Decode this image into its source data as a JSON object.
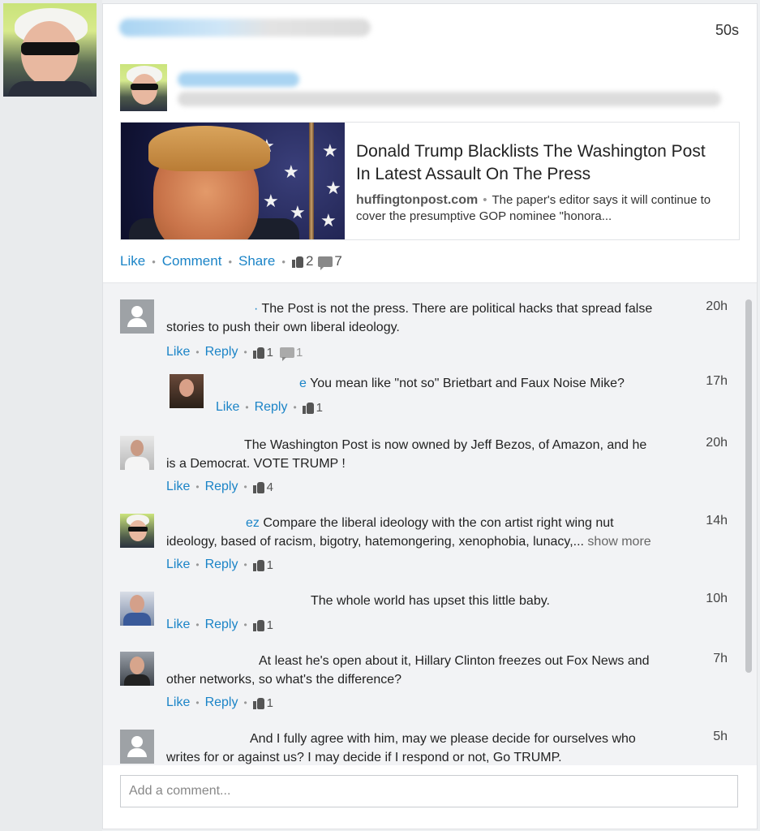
{
  "post": {
    "time": "50s",
    "article": {
      "title": "Donald Trump Blacklists The Washington Post In Latest Assault On The Press",
      "source": "huffingtonpost.com",
      "snippet": "The paper's editor says it will continue to cover the presumptive GOP nominee \"honora..."
    },
    "actions": {
      "like": "Like",
      "comment": "Comment",
      "share": "Share",
      "likes_count": "2",
      "comments_count": "7"
    }
  },
  "comments": [
    {
      "text": "The Post is not the press. There are political hacks that spread false stories to push their own liberal ideology.",
      "prefix": "·",
      "time": "20h",
      "like": "Like",
      "reply": "Reply",
      "likes": "1",
      "replies": "1"
    },
    {
      "text": "You mean like \"not so\" Brietbart and Faux Noise Mike?",
      "prefix": "e",
      "time": "17h",
      "like": "Like",
      "reply": "Reply",
      "likes": "1"
    },
    {
      "text_line1": "The Washington Post is now owned by Jeff Bezos, of Amazon, and he",
      "text_line2": "is a Democrat. VOTE TRUMP !",
      "time": "20h",
      "like": "Like",
      "reply": "Reply",
      "likes": "4"
    },
    {
      "prefix": "ez",
      "text_line1": "Compare the liberal ideology with the con artist right wing nut",
      "text_line2": "ideology, based of racism, bigotry, hatemongering, xenophobia, lunacy,...",
      "show_more": "show more",
      "time": "14h",
      "like": "Like",
      "reply": "Reply",
      "likes": "1"
    },
    {
      "text": "The whole world has upset this little baby.",
      "time": "10h",
      "like": "Like",
      "reply": "Reply",
      "likes": "1"
    },
    {
      "text_line1": "At least he's open about it, Hillary Clinton freezes out Fox News and",
      "text_line2": "other networks, so what's the difference?",
      "time": "7h",
      "like": "Like",
      "reply": "Reply",
      "likes": "1"
    },
    {
      "text_line1": "And I fully agree with him, may we please decide for ourselves who",
      "text_line2": "writes for or against us? I may decide if I respond or not, Go TRUMP.",
      "time": "5h"
    }
  ],
  "comment_input": {
    "placeholder": "Add a comment..."
  },
  "colors": {
    "link": "#1b84c7",
    "background": "#eef0f2",
    "card": "#ffffff"
  }
}
